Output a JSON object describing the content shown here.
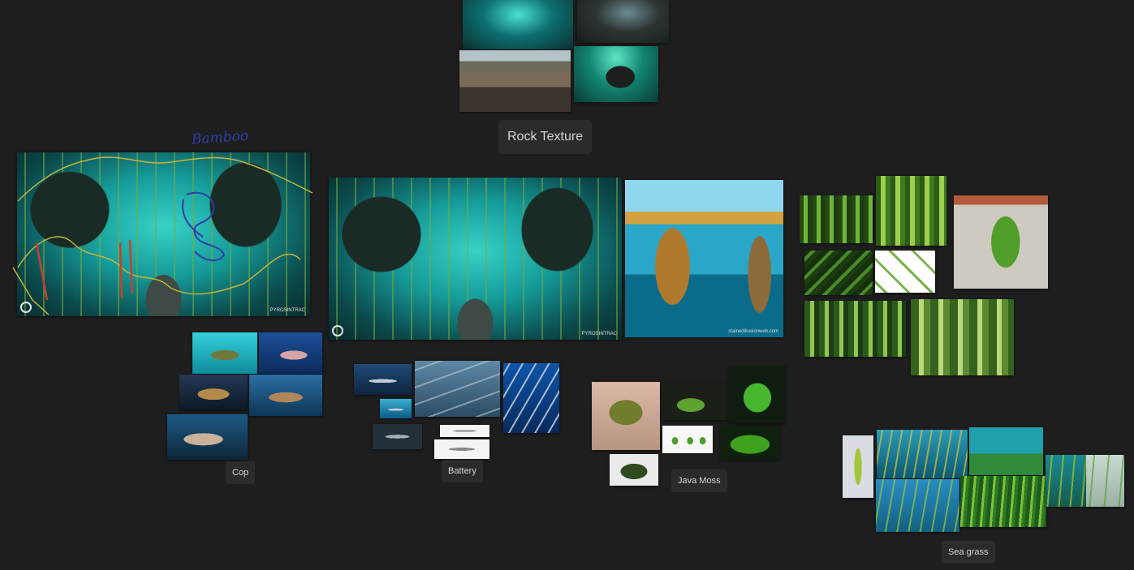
{
  "labels": {
    "rock_texture": "Rock Texture",
    "cop": "Cop",
    "battery": "Battery",
    "java_moss": "Java Moss",
    "sea_grass": "Sea grass"
  },
  "annotation": {
    "handwritten": "Bamboo"
  },
  "watermarks": {
    "concept_1": "PYROSINTRAC",
    "concept_2": "PYROSINTRAC",
    "pagoda": "stainedillusionweb.com"
  },
  "colors": {
    "canvas_bg": "#1e1e1e",
    "label_bg": "#2b2b2b",
    "label_text": "#d6d6d6",
    "outline_yellow": "#c8b43a",
    "scribble_blue": "#2f3ea6",
    "highlight_red": "#c8402a"
  }
}
